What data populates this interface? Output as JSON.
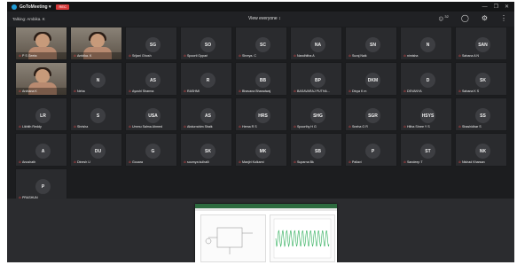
{
  "app": {
    "title": "GoToMeeting ▾",
    "rec": "REC",
    "window_controls": [
      "—",
      "❐",
      "✕"
    ]
  },
  "toolbar": {
    "talking": "Talking: Ambika. K",
    "layout": "View everyone ↕",
    "icons": [
      "participants-count-icon",
      "chat-bubble-icon",
      "settings-icon",
      "more-menu-icon"
    ],
    "participant_count": "32"
  },
  "tiles": [
    {
      "initials": "",
      "name": "P S Geeta",
      "video": true
    },
    {
      "initials": "",
      "name": "Ambika. K",
      "video": true
    },
    {
      "initials": "SG",
      "name": "Srijani Ghosh"
    },
    {
      "initials": "SO",
      "name": "Spoorti Oppari"
    },
    {
      "initials": "SC",
      "name": "Shreya. C"
    },
    {
      "initials": "NA",
      "name": "Nandhitha A"
    },
    {
      "initials": "SN",
      "name": "Suraj Naik"
    },
    {
      "initials": "N",
      "name": "nimisha"
    },
    {
      "initials": "SAN",
      "name": "Sahana A N"
    },
    {
      "initials": "",
      "name": "Archana K",
      "video": true
    },
    {
      "initials": "N",
      "name": "Neha"
    },
    {
      "initials": "AS",
      "name": "Ayushi Sharma"
    },
    {
      "initials": "R",
      "name": "RASHMI"
    },
    {
      "initials": "BB",
      "name": "Bhavana Bharadwaj"
    },
    {
      "initials": "BP",
      "name": "BASAVARAJ PUTHA..."
    },
    {
      "initials": "DKM",
      "name": "Divya K m"
    },
    {
      "initials": "D",
      "name": "DEVANYA"
    },
    {
      "initials": "SK",
      "name": "Sahana K S"
    },
    {
      "initials": "LR",
      "name": "Likhith Reddy"
    },
    {
      "initials": "S",
      "name": "Shrisha"
    },
    {
      "initials": "USA",
      "name": "Ummu Salma Ahmed"
    },
    {
      "initials": "AS",
      "name": "Abdurrahim Shaik"
    },
    {
      "initials": "HRS",
      "name": "Hema R S"
    },
    {
      "initials": "SHG",
      "name": "Spoorthy H G"
    },
    {
      "initials": "SGR",
      "name": "Sneha G R"
    },
    {
      "initials": "HSYS",
      "name": "Hitha Shree Y S"
    },
    {
      "initials": "SS",
      "name": "Shashidhar S"
    },
    {
      "initials": "A",
      "name": "Anushath"
    },
    {
      "initials": "DU",
      "name": "Dinesh U"
    },
    {
      "initials": "G",
      "name": "Gouara"
    },
    {
      "initials": "SK",
      "name": "soumya kulhalli"
    },
    {
      "initials": "MK",
      "name": "Manjiri Kulkarni"
    },
    {
      "initials": "SB",
      "name": "Suparna Bk"
    },
    {
      "initials": "P",
      "name": "Pallavi"
    },
    {
      "initials": "ST",
      "name": "Sandeep T"
    },
    {
      "initials": "NK",
      "name": "Nishad Kharsan"
    },
    {
      "initials": "P",
      "name": "PRASHUN"
    }
  ],
  "colors": {
    "background": "#1c1d1f",
    "tile": "#2a2b2e",
    "avatar": "#3d3e42",
    "muted_mic": "#e24a4a",
    "rec": "#d83a3a",
    "brand": "#1e9bd7"
  }
}
